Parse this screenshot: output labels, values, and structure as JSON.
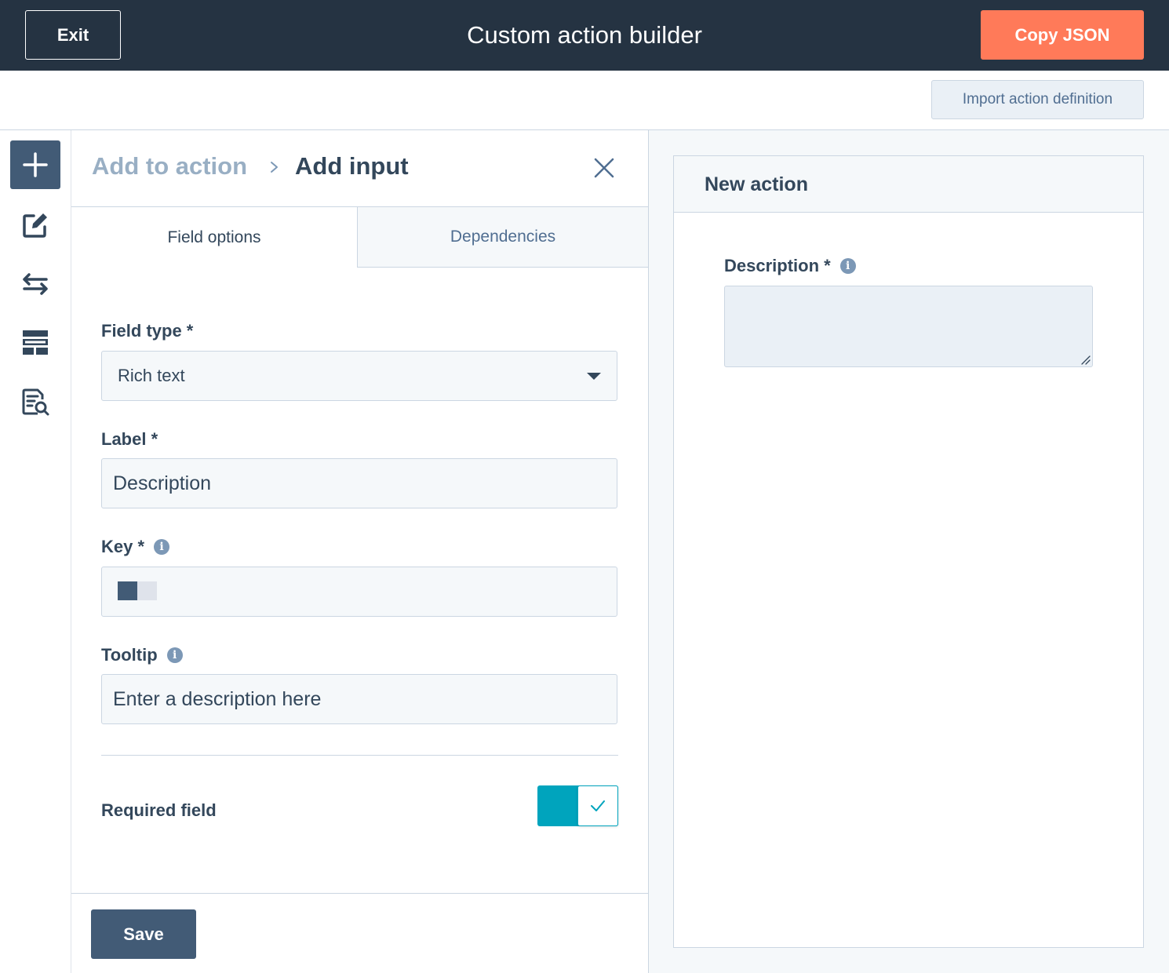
{
  "topbar": {
    "exit_label": "Exit",
    "title": "Custom action builder",
    "copy_json_label": "Copy JSON",
    "copy_json_color": "#ff7a59",
    "background_color": "#253342"
  },
  "subbar": {
    "import_label": "Import action definition"
  },
  "rail": {
    "items": [
      {
        "icon": "plus-icon",
        "active": true
      },
      {
        "icon": "edit-icon",
        "active": false
      },
      {
        "icon": "swap-arrows-icon",
        "active": false
      },
      {
        "icon": "table-layout-icon",
        "active": false
      },
      {
        "icon": "document-search-icon",
        "active": false
      }
    ]
  },
  "panel": {
    "breadcrumb_parent": "Add to action",
    "breadcrumb_current": "Add input",
    "tabs": [
      {
        "label": "Field options",
        "active": true
      },
      {
        "label": "Dependencies",
        "active": false
      }
    ],
    "field_type": {
      "label": "Field type *",
      "value": "Rich text"
    },
    "label_field": {
      "label": "Label *",
      "value": "Description"
    },
    "key_field": {
      "label": "Key *",
      "info_icon": "i"
    },
    "tooltip_field": {
      "label": "Tooltip",
      "info_icon": "i",
      "placeholder": "Enter a description here"
    },
    "required_field": {
      "label": "Required field",
      "enabled": true,
      "accent_color": "#00a4bd"
    },
    "save_label": "Save"
  },
  "preview": {
    "title": "New action",
    "field_label": "Description *",
    "info_icon": "i"
  }
}
